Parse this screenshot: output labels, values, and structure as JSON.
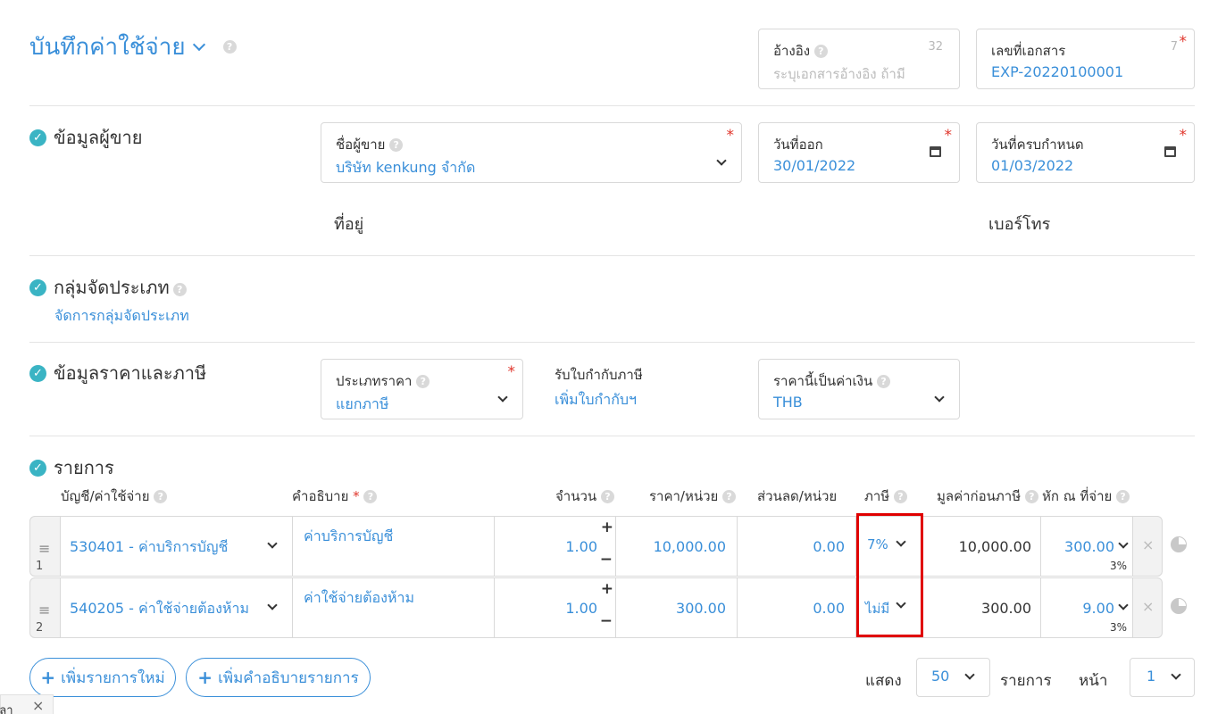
{
  "header": {
    "title": "บันทึกค่าใช้จ่าย",
    "ref": {
      "label": "อ้างอิง",
      "count": "32",
      "placeholder": "ระบุเอกสารอ้างอิง ถ้ามี"
    },
    "docno": {
      "label": "เลขที่เอกสาร",
      "count": "7",
      "value": "EXP-20220100001"
    }
  },
  "vendor": {
    "section": "ข้อมูลผู้ขาย",
    "name_label": "ชื่อผู้ขาย",
    "name_value": "บริษัท kenkung จำกัด",
    "issue_label": "วันที่ออก",
    "issue_value": "30/01/2022",
    "due_label": "วันที่ครบกำหนด",
    "due_value": "01/03/2022",
    "address_label": "ที่อยู่",
    "phone_label": "เบอร์โทร"
  },
  "category": {
    "section": "กลุ่มจัดประเภท",
    "link": "จัดการกลุ่มจัดประเภท"
  },
  "pricing": {
    "section": "ข้อมูลราคาและภาษี",
    "type_label": "ประเภทราคา",
    "type_value": "แยกภาษี",
    "tax_invoice_label": "รับใบกำกับภาษี",
    "tax_invoice_link": "เพิ่มใบกำกับฯ",
    "currency_label": "ราคานี้เป็นค่าเงิน",
    "currency_value": "THB"
  },
  "items": {
    "section": "รายการ",
    "headers": {
      "account": "บัญชี/ค่าใช้จ่าย",
      "description": "คำอธิบาย",
      "qty": "จำนวน",
      "price": "ราคา/หน่วย",
      "discount": "ส่วนลด/หน่วย",
      "tax": "ภาษี",
      "pretax": "มูลค่าก่อนภาษี",
      "wht": "หัก ณ ที่จ่าย"
    },
    "rows": [
      {
        "no": "1",
        "account": "530401 - ค่าบริการบัญชี",
        "description": "ค่าบริการบัญชี",
        "qty": "1.00",
        "price": "10,000.00",
        "discount": "0.00",
        "tax": "7%",
        "pretax": "10,000.00",
        "wht": "300.00",
        "wht_rate": "3%"
      },
      {
        "no": "2",
        "account": "540205 - ค่าใช้จ่ายต้องห้าม",
        "description": "ค่าใช้จ่ายต้องห้าม",
        "qty": "1.00",
        "price": "300.00",
        "discount": "0.00",
        "tax": "ไม่มี",
        "pretax": "300.00",
        "wht": "9.00",
        "wht_rate": "3%"
      }
    ],
    "add_item": "เพิ่มรายการใหม่",
    "add_desc": "เพิ่มคำอธิบายรายการ"
  },
  "pagination": {
    "show_label": "แสดง",
    "per_page": "50",
    "items_label": "รายการ",
    "page_label": "หน้า",
    "page": "1"
  },
  "toast": {
    "text": "ปลา"
  },
  "colors": {
    "accent": "#3a8fd9",
    "check": "#3ab4c4",
    "required": "#e0352b",
    "highlight": "#e00000"
  }
}
